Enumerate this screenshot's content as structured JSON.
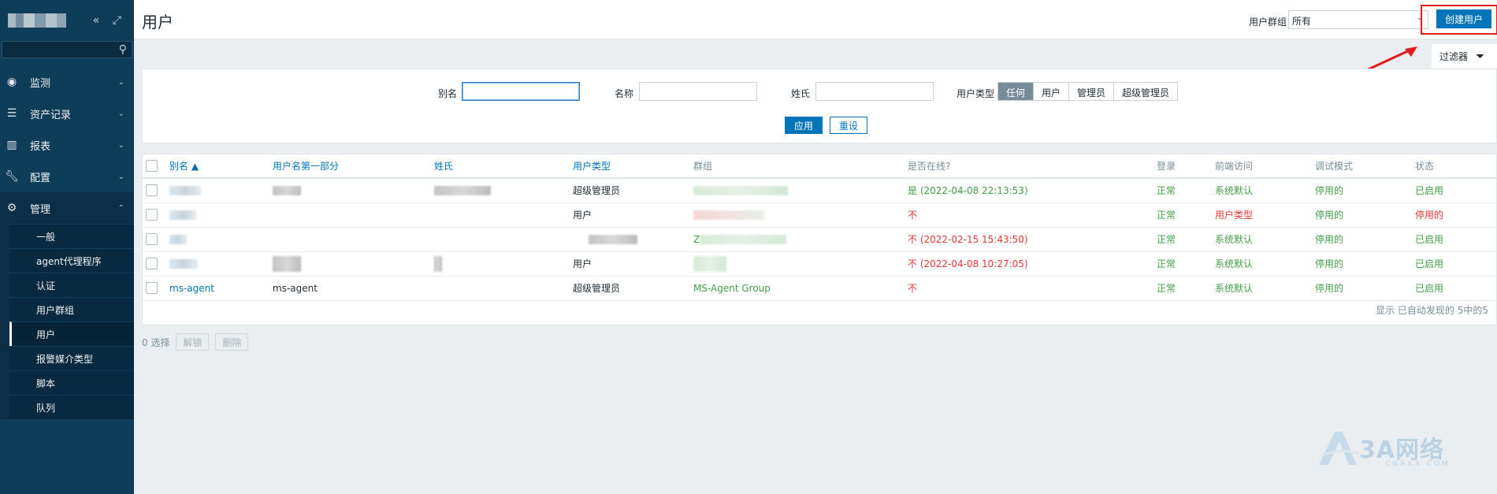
{
  "sidebar": {
    "search_placeholder": "",
    "menu": [
      {
        "label": "监测",
        "icon": "eye-icon"
      },
      {
        "label": "资产记录",
        "icon": "list-icon"
      },
      {
        "label": "报表",
        "icon": "chart-icon"
      },
      {
        "label": "配置",
        "icon": "wrench-icon"
      },
      {
        "label": "管理",
        "icon": "gear-icon"
      }
    ],
    "submenu": [
      "一般",
      "agent代理程序",
      "认证",
      "用户群组",
      "用户",
      "报警媒介类型",
      "脚本",
      "队列"
    ]
  },
  "header": {
    "title": "用户",
    "group_label": "用户群组",
    "group_value": "所有",
    "create_button": "创建用户",
    "filter_tab": "过滤器"
  },
  "filter": {
    "alias_label": "别名",
    "name_label": "名称",
    "surname_label": "姓氏",
    "type_label": "用户类型",
    "type_options": [
      "任何",
      "用户",
      "管理员",
      "超级管理员"
    ],
    "apply": "应用",
    "reset": "重设"
  },
  "table": {
    "headers": [
      "别名 ▲",
      "用户名第一部分",
      "姓氏",
      "用户类型",
      "群组",
      "是否在线?",
      "登录",
      "前端访问",
      "调试模式",
      "状态"
    ],
    "rows": [
      {
        "alias": "",
        "name": "",
        "surname": "",
        "type": "超级管理员",
        "group": "",
        "online": "是 (2022-04-08 22:13:53)",
        "login": "正常",
        "frontend": "系统默认",
        "debug": "停用的",
        "status": "已启用"
      },
      {
        "alias": "",
        "name": "",
        "surname": "",
        "type": "用户",
        "group": "",
        "online": "不",
        "login": "正常",
        "frontend": "用户类型",
        "debug": "停用的",
        "status": "停用的"
      },
      {
        "alias": "",
        "name": "",
        "surname": "",
        "type": "",
        "group": "Z",
        "online": "不 (2022-02-15 15:43:50)",
        "login": "正常",
        "frontend": "系统默认",
        "debug": "停用的",
        "status": "已启用"
      },
      {
        "alias": "",
        "name": "",
        "surname": "",
        "type": "用户",
        "group": "",
        "online": "不 (2022-04-08 10:27:05)",
        "login": "正常",
        "frontend": "系统默认",
        "debug": "停用的",
        "status": "已启用"
      },
      {
        "alias": "ms-agent",
        "name": "ms-agent",
        "surname": "",
        "type": "超级管理员",
        "group": "MS-Agent Group",
        "online": "不",
        "login": "正常",
        "frontend": "系统默认",
        "debug": "停用的",
        "status": "已启用"
      }
    ],
    "footer": "显示 已自动发现的 5中的5"
  },
  "bottom": {
    "selected": "0 选择",
    "unlock": "解锁",
    "delete": "删除"
  },
  "watermark": {
    "main": "3A网络",
    "sub": "CNAAA.COM"
  }
}
